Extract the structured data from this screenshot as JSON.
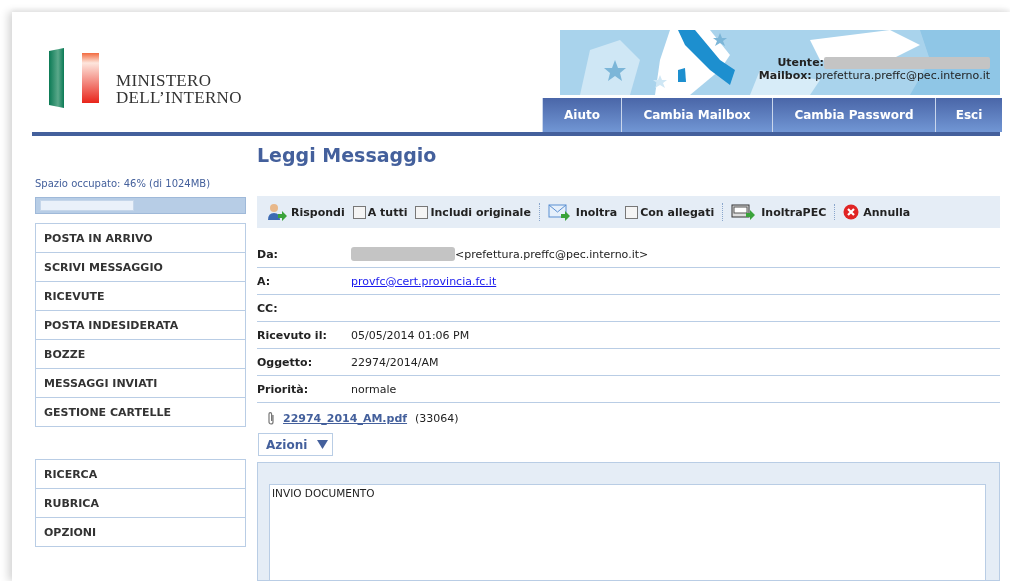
{
  "logo": {
    "line_1": "MINISTERO",
    "line_2": "DELL’INTERNO"
  },
  "user": {
    "user_label": "Utente:",
    "user_redacted": true,
    "mailbox_label": "Mailbox:",
    "mailbox": "prefettura.preffc@pec.interno.it"
  },
  "nav": [
    "Aiuto",
    "Cambia Mailbox",
    "Cambia Password",
    "Esci"
  ],
  "page_title": "Leggi Messaggio",
  "quota": {
    "label": "Spazio occupato: 46% (di 1024MB)",
    "level": 0.46
  },
  "sidebar": {
    "groups": [
      [
        "POSTA IN ARRIVO",
        "SCRIVI MESSAGGIO",
        "RICEVUTE",
        "POSTA INDESIDERATA",
        "BOZZE",
        "MESSAGGI INVIATI",
        "GESTIONE CARTELLE"
      ],
      [
        "RICERCA",
        "RUBRICA",
        "OPZIONI"
      ]
    ]
  },
  "toolbar": [
    [
      {
        "kind": "reply",
        "label": "Rispondi"
      },
      {
        "kind": "check",
        "label": "A tutti",
        "checked": false
      },
      {
        "kind": "check",
        "label": "Includi originale",
        "checked": false
      }
    ],
    [
      {
        "kind": "forward",
        "label": "Inoltra"
      },
      {
        "kind": "check",
        "label": "Con allegati",
        "checked": false
      }
    ],
    [
      {
        "kind": "forward-pec",
        "label": "InoltraPEC"
      }
    ],
    [
      {
        "kind": "cancel",
        "label": "Annulla"
      }
    ]
  ],
  "fields": [
    {
      "label": "Da:",
      "value": "<prefettura.preffc@pec.interno.it>",
      "redacted": true,
      "link": false
    },
    {
      "label": "A:",
      "value": "provfc@cert.provincia.fc.it",
      "redacted": false,
      "link": true
    },
    {
      "label": "CC:",
      "redacted": false,
      "link": false
    },
    {
      "label": "Ricevuto il:",
      "value": "05/05/2014 01:06 PM",
      "redacted": false,
      "link": false
    },
    {
      "label": "Oggetto:",
      "value": "22974/2014/AM",
      "redacted": false,
      "link": false
    },
    {
      "label": "Priorità:",
      "value": "normale",
      "redacted": false,
      "link": false
    }
  ],
  "attachment": {
    "name": "22974_2014_AM.pdf",
    "size": "(33064)"
  },
  "actions_button": "Azioni",
  "body": "INVIO DOCUMENTO"
}
